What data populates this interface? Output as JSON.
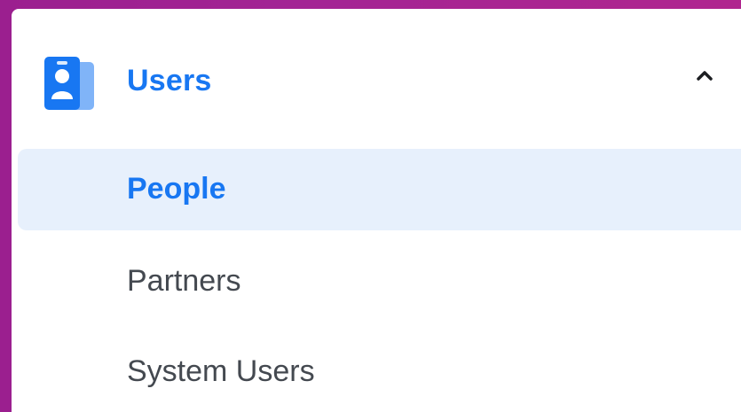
{
  "section": {
    "title": "Users",
    "icon": "users-icon",
    "expanded": true,
    "accent_color": "#1877f2",
    "items": [
      {
        "label": "People",
        "active": true
      },
      {
        "label": "Partners",
        "active": false
      },
      {
        "label": "System Users",
        "active": false
      }
    ]
  },
  "colors": {
    "active_bg": "#e7f0fc",
    "text": "#444950",
    "frame": "#a32494"
  }
}
